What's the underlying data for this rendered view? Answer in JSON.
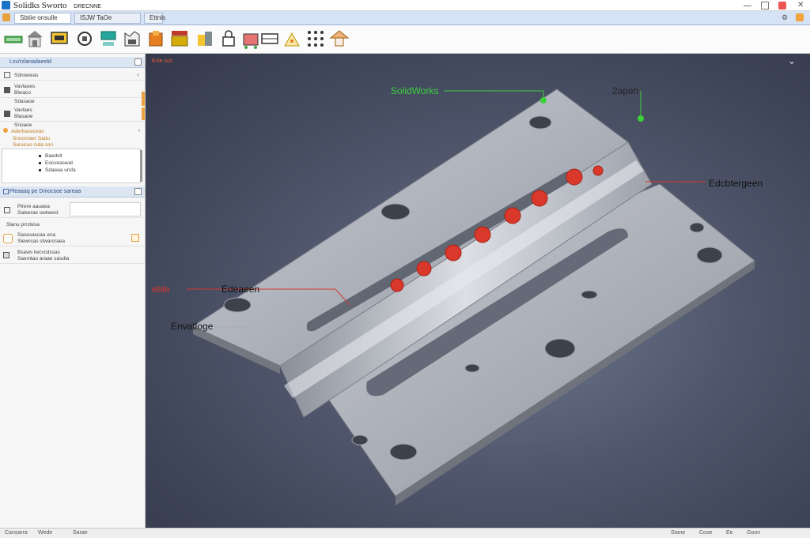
{
  "window": {
    "title": "Solidks Sworto",
    "subtitle": "DRECNNE"
  },
  "tabs": [
    {
      "label": "Sbtiie onsulle"
    },
    {
      "label": "ISJW  TaOe"
    },
    {
      "label": "Ettnls"
    }
  ],
  "toolbar": {
    "buttons": [
      "extrude-icon",
      "house-icon",
      "sketch-icon",
      "rotate-icon",
      "display-icon",
      "feature-icon",
      "cube-icon",
      "assembly-icon",
      "parts-icon",
      "lock-icon",
      "fillet-icon",
      "table-icon",
      "measure-icon",
      "pattern-icon",
      "home-icon"
    ]
  },
  "left_panel": {
    "header": "Lsv/rzlanadaeeld",
    "section_label": "Sdnoewas",
    "item1": {
      "line1": "Vavlaoes",
      "line2": "Blwaco"
    },
    "sub_header": "Sdasaoe",
    "item2": {
      "line1": "Vavlaes",
      "line2": "Blasaoe"
    },
    "item2_line3": "Snoaoe",
    "warning1": "Aderbaceceas",
    "warning2": "Snocroaer Sadu",
    "warning3": "Sanuruo rsda ssn",
    "tree_items": [
      "Baedvlt",
      "Eocveaswat",
      "Sdaeaa ursfa"
    ],
    "section2_header": "Pleaaaq pe Dmocsoe sareaa",
    "property": {
      "line1": "Plrere aauaea",
      "line2": "Saleerae swtwerd"
    },
    "group_label": "Slanu prrctesa",
    "option1": {
      "line1": "Sasesascaa  ena",
      "line2": "Slewrcas stwarcraea"
    },
    "option2": {
      "line1": "Bsaws lwcvcdssas",
      "line2": "Saemtao araae sasdta"
    }
  },
  "viewport": {
    "tag": "Exle sos",
    "annotations": {
      "label_top": "SolidWorks",
      "label_top_right": "2apeh",
      "label_right": "Edcbtergeen",
      "label_left_red": "eble",
      "label_left_mid": "Edeaeen",
      "label_bottom_left": "Envatloge"
    },
    "colors": {
      "green": "#3ad13a",
      "red": "#d9382b",
      "metal": "#b8bcc4"
    }
  },
  "status": {
    "left": "Cansarra",
    "mid": "Wede",
    "mid2": "Sarae",
    "right": [
      "Stane",
      "Cose",
      "Ee",
      "Goon"
    ]
  }
}
